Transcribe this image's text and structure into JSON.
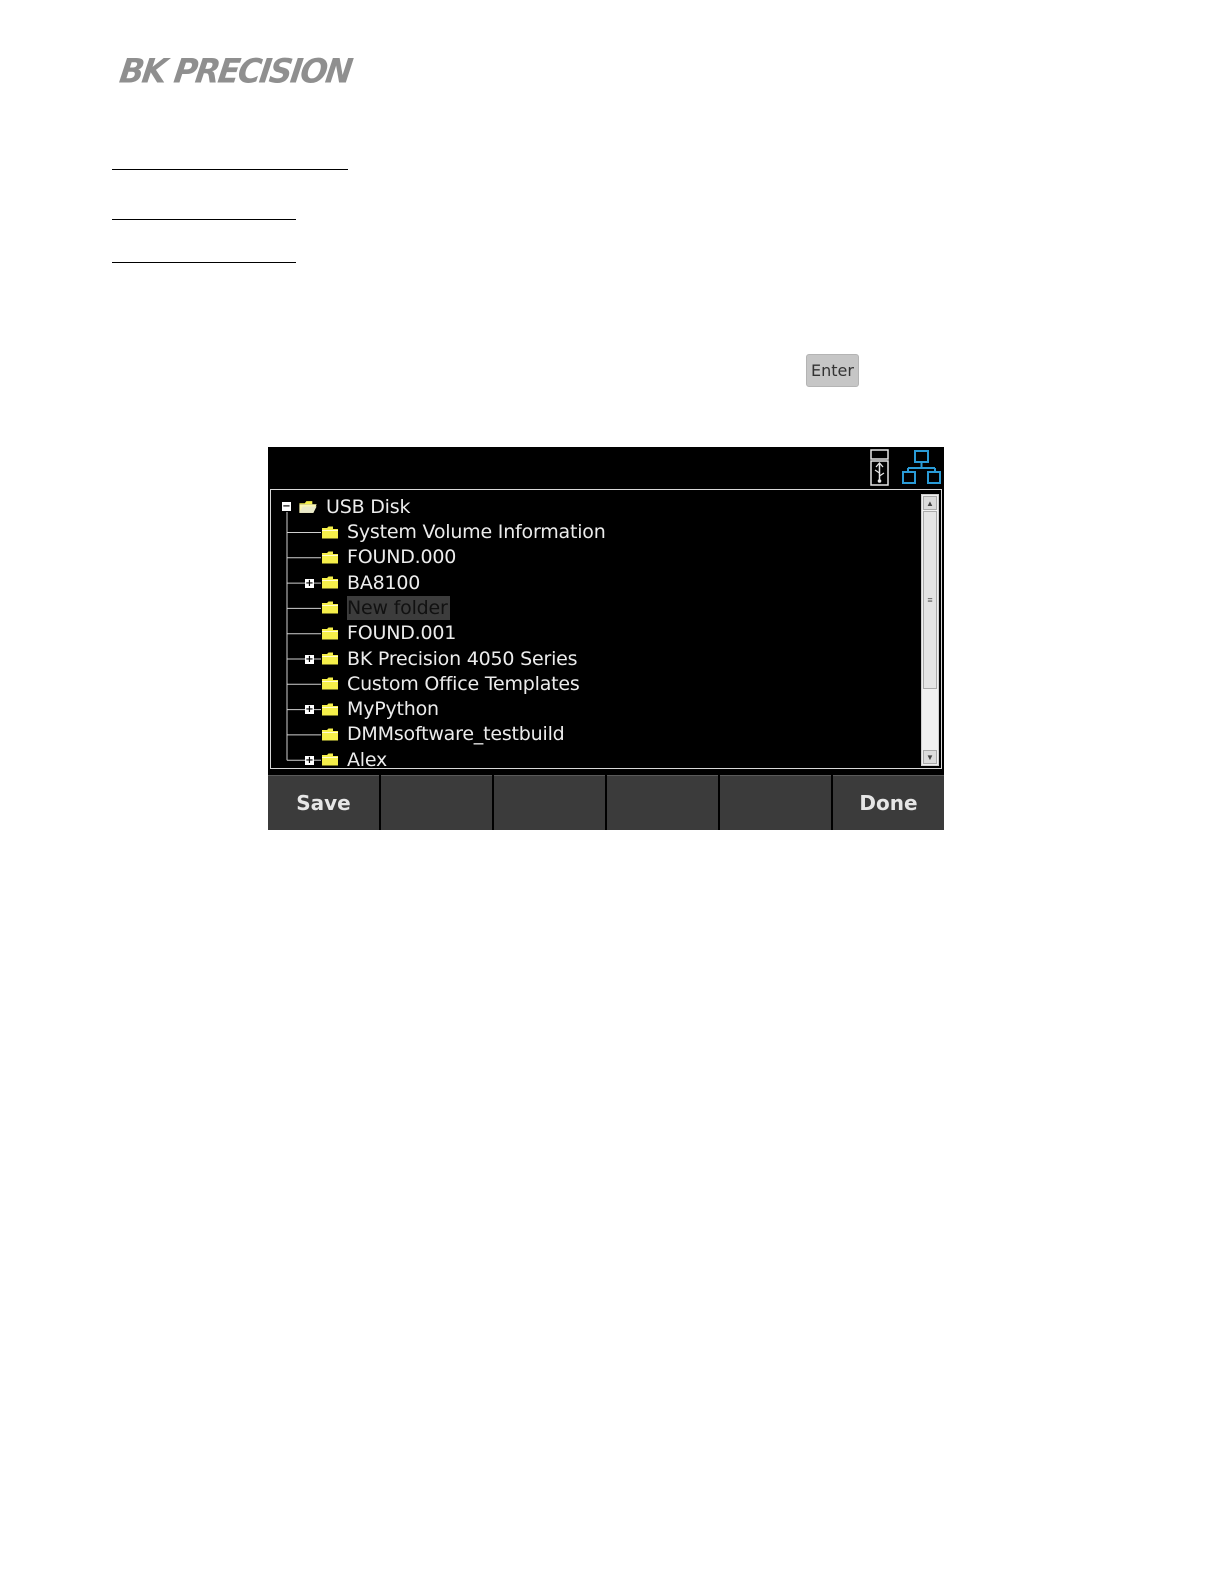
{
  "header": {
    "logo_text": "BK PRECISION"
  },
  "instructions": {
    "key_label": "Enter"
  },
  "screen": {
    "status_icons": [
      "usb-storage-icon",
      "network-icon"
    ],
    "tree": {
      "root": "USB Disk",
      "items": [
        {
          "label": "System Volume Information",
          "expandable": false
        },
        {
          "label": "FOUND.000",
          "expandable": false
        },
        {
          "label": "BA8100",
          "expandable": true
        },
        {
          "label": "New folder",
          "expandable": false,
          "selected": true
        },
        {
          "label": "FOUND.001",
          "expandable": false
        },
        {
          "label": "BK Precision 4050 Series",
          "expandable": true
        },
        {
          "label": "Custom Office Templates",
          "expandable": false
        },
        {
          "label": "MyPython",
          "expandable": true
        },
        {
          "label": "DMMsoftware_testbuild",
          "expandable": false
        },
        {
          "label": "Alex",
          "expandable": true
        }
      ]
    },
    "softkeys": [
      "Save",
      "",
      "",
      "",
      "",
      "Done"
    ]
  },
  "colors": {
    "folder": "#f5ef4a",
    "network_icon": "#2a9bd6",
    "screen_bg": "#000000",
    "softkey_bg": "#3b3b3b"
  }
}
